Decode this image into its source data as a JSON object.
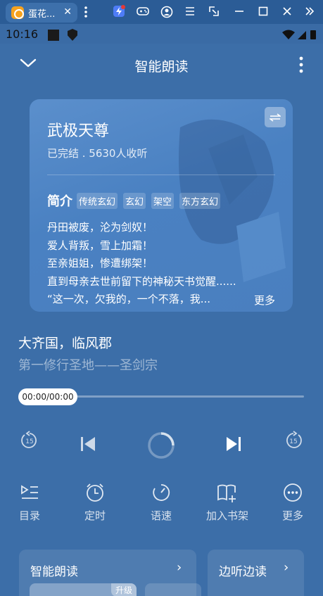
{
  "emulator": {
    "tab_title": "蛋花...",
    "tab_close": "✕",
    "icons": [
      "app-icon",
      "shortcut-icon",
      "gamepad-icon",
      "account-icon",
      "menu-icon",
      "screen-icon",
      "minimize-icon",
      "maximize-icon",
      "close-icon",
      "expand-icon"
    ]
  },
  "status_bar": {
    "time": "10:16"
  },
  "header": {
    "title": "智能朗读"
  },
  "book": {
    "title": "武极天尊",
    "meta": "已完结 . 5630人收听",
    "intro_label": "简介",
    "tags": [
      "传统玄幻",
      "玄幻",
      "架空",
      "东方玄幻"
    ],
    "synopsis": [
      "丹田被废，沦为剑奴！",
      "爱人背叛，雪上加霜！",
      "至亲姐姐，惨遭绑架！",
      "直到母亲去世前留下的神秘天书觉醒......",
      "“这一次，欠我的，一个不落，我..."
    ],
    "more_label": "更多"
  },
  "chapter": {
    "title": "大齐国，临风郡",
    "subtitle": "第一修行圣地——圣剑宗"
  },
  "player": {
    "time_display": "00:00/00:00",
    "progress": 0,
    "rewind_seconds": "15",
    "forward_seconds": "15"
  },
  "tools": [
    {
      "label": "目录",
      "icon": "catalog-icon"
    },
    {
      "label": "定时",
      "icon": "timer-icon"
    },
    {
      "label": "语速",
      "icon": "speed-icon"
    },
    {
      "label": "加入书架",
      "icon": "add-bookshelf-icon"
    },
    {
      "label": "更多",
      "icon": "more-icon"
    }
  ],
  "panels": {
    "smart_read": {
      "title": "智能朗读",
      "arrow": "›",
      "upgrade_label": "升级"
    },
    "listen_read": {
      "title": "边听边读",
      "arrow": "›"
    }
  },
  "colors": {
    "background": "#3c6ea8",
    "card": "#4a81c2",
    "emulator_bar": "#2b5c96"
  }
}
